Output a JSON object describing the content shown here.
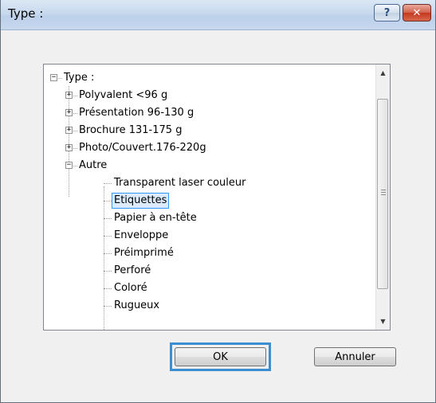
{
  "window": {
    "title": "Type :",
    "help_label": "?",
    "close_label": "✕"
  },
  "tree": {
    "root": {
      "label": "Type :",
      "expander": "−"
    },
    "groups": [
      {
        "label": "Polyvalent <96 g",
        "expander": "+"
      },
      {
        "label": "Présentation 96-130 g",
        "expander": "+"
      },
      {
        "label": "Brochure 131-175 g",
        "expander": "+"
      },
      {
        "label": "Photo/Couvert.176-220g",
        "expander": "+"
      },
      {
        "label": "Autre",
        "expander": "−"
      }
    ],
    "autre_children": [
      "Transparent laser couleur",
      "Etiquettes",
      "Papier à en-tête",
      "Enveloppe",
      "Préimprimé",
      "Perforé",
      "Coloré",
      "Rugueux"
    ],
    "selected_item": "Etiquettes"
  },
  "scrollbar": {
    "up_icon": "▲",
    "down_icon": "▼"
  },
  "buttons": {
    "ok": "OK",
    "cancel": "Annuler"
  }
}
